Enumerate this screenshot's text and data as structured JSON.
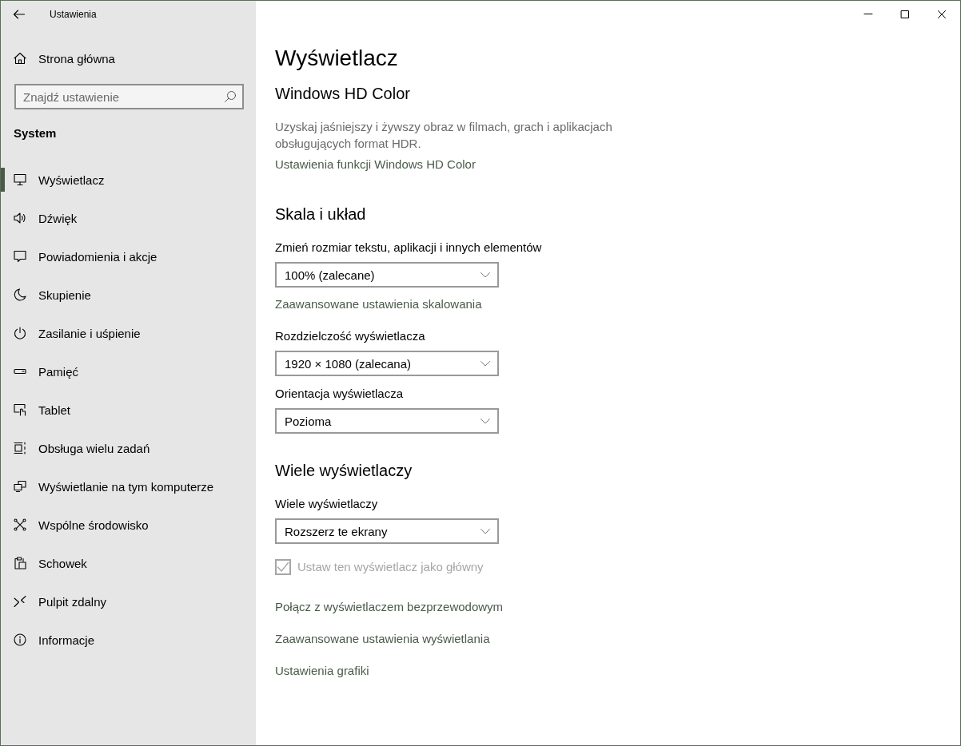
{
  "window": {
    "title": "Ustawienia"
  },
  "sidebar": {
    "home": "Strona główna",
    "search": {
      "placeholder": "Znajdź ustawienie"
    },
    "section": "System",
    "items": [
      {
        "label": "Wyświetlacz",
        "selected": true
      },
      {
        "label": "Dźwięk",
        "selected": false
      },
      {
        "label": "Powiadomienia i akcje",
        "selected": false
      },
      {
        "label": "Skupienie",
        "selected": false
      },
      {
        "label": "Zasilanie i uśpienie",
        "selected": false
      },
      {
        "label": "Pamięć",
        "selected": false
      },
      {
        "label": "Tablet",
        "selected": false
      },
      {
        "label": "Obsługa wielu zadań",
        "selected": false
      },
      {
        "label": "Wyświetlanie na tym komputerze",
        "selected": false
      },
      {
        "label": "Wspólne środowisko",
        "selected": false
      },
      {
        "label": "Schowek",
        "selected": false
      },
      {
        "label": "Pulpit zdalny",
        "selected": false
      },
      {
        "label": "Informacje",
        "selected": false
      }
    ]
  },
  "page": {
    "title": "Wyświetlacz",
    "sections": [
      {
        "heading": "Windows HD Color",
        "items": [
          {
            "kind": "description",
            "text": "Uzyskaj jaśniejszy i żywszy obraz w filmach, grach i aplikacjach obsługujących format HDR."
          },
          {
            "kind": "link",
            "text": "Ustawienia funkcji Windows HD Color"
          }
        ]
      },
      {
        "heading": "Skala i układ",
        "items": [
          {
            "kind": "dropdown",
            "label": "Zmień rozmiar tekstu, aplikacji i innych elementów",
            "value": "100% (zalecane)"
          },
          {
            "kind": "link",
            "text": "Zaawansowane ustawienia skalowania"
          },
          {
            "kind": "dropdown",
            "label": "Rozdzielczość wyświetlacza",
            "value": "1920 × 1080 (zalecana)"
          },
          {
            "kind": "dropdown",
            "label": "Orientacja wyświetlacza",
            "value": "Pozioma"
          }
        ]
      },
      {
        "heading": "Wiele wyświetlaczy",
        "items": [
          {
            "kind": "dropdown",
            "label": "Wiele wyświetlaczy",
            "value": "Rozszerz te ekrany"
          },
          {
            "kind": "checkbox",
            "label": "Ustaw ten wyświetlacz jako główny",
            "checked": true,
            "disabled": true
          },
          {
            "kind": "link",
            "text": "Połącz z wyświetlaczem bezprzewodowym"
          },
          {
            "kind": "link",
            "text": "Zaawansowane ustawienia wyświetlania"
          },
          {
            "kind": "link",
            "text": "Ustawienia grafiki"
          }
        ]
      }
    ]
  }
}
